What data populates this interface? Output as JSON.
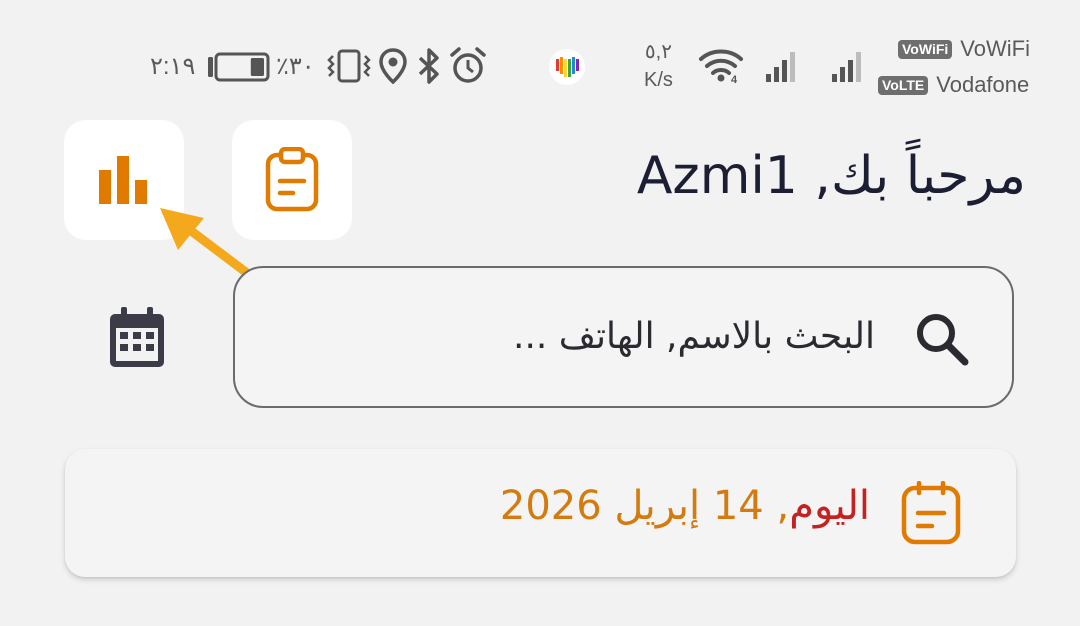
{
  "status_bar": {
    "time": "٢:١٩",
    "battery_percent": "٪٣٠",
    "speed_value": "٥,٢",
    "speed_unit": "K/s",
    "vowifi_badge": "VoWiFi",
    "vowifi_label": "VoWiFi",
    "volte_badge": "VoLTE",
    "carrier": "Vodafone",
    "battery_level": 0.3,
    "icons": [
      "vibrate-icon",
      "location-icon",
      "bluetooth-icon",
      "alarm-icon",
      "app-heart-icon",
      "wifi-icon",
      "signal-icon"
    ]
  },
  "header": {
    "greeting": "مرحباً بك, Azmi1",
    "stats_button_icon": "bar-chart-icon",
    "clipboard_button_icon": "clipboard-icon"
  },
  "search": {
    "placeholder": "البحث بالاسم, الهاتف ..."
  },
  "date_card": {
    "today_label": "اليوم",
    "separator": ",",
    "date_value": "14 إبريل 2026"
  },
  "colors": {
    "background": "#f2f2f3",
    "accent_orange": "#e07b00",
    "today_red": "#c62121",
    "date_orange": "#d47b10",
    "arrow_yellow": "#f4a91c",
    "title_navy": "#1c1f33"
  }
}
